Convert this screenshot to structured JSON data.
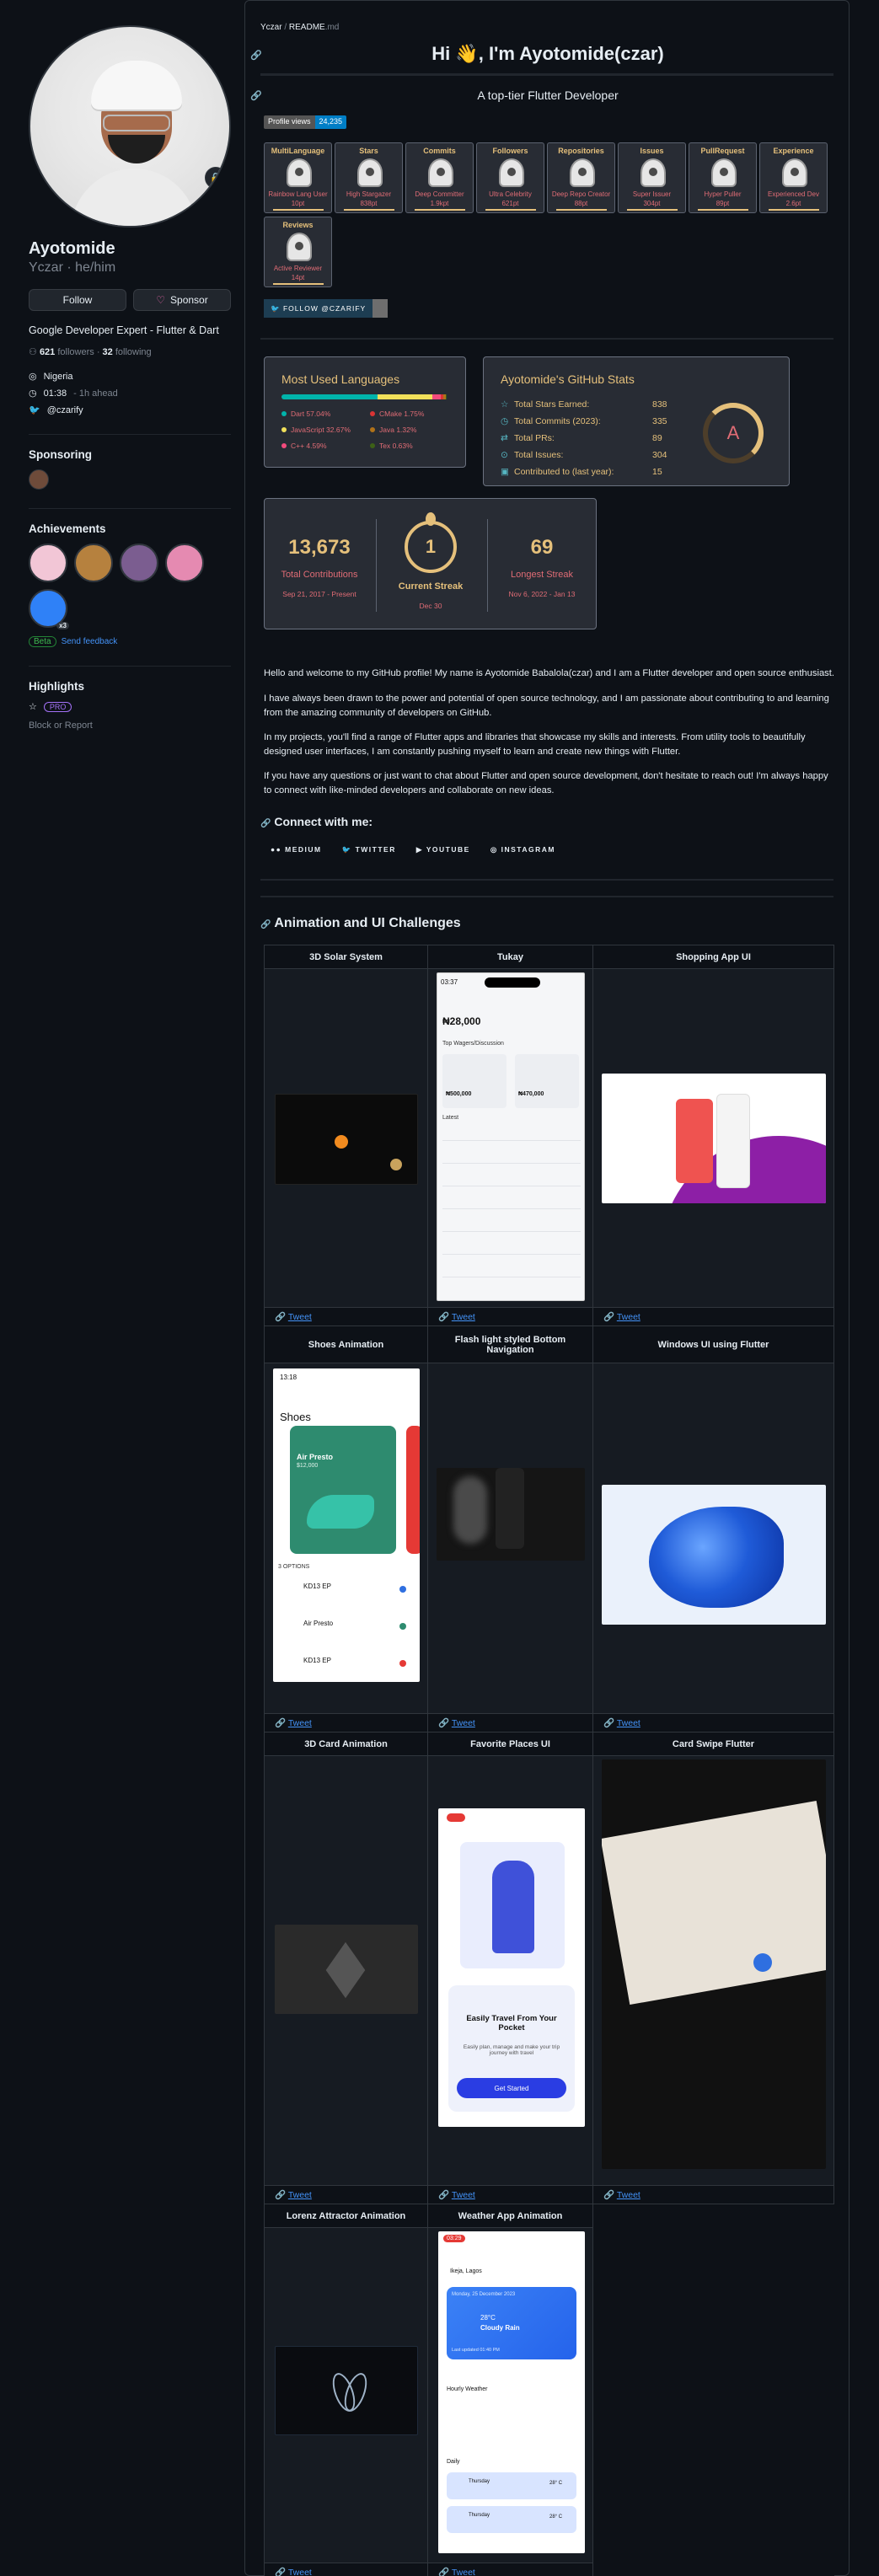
{
  "profile": {
    "name": "Ayotomide",
    "login": "Yczar · he/him",
    "follow_label": "Follow",
    "sponsor_label": "Sponsor",
    "bio": "Google Developer Expert - Flutter & Dart",
    "followers_count": "621",
    "followers_label": "followers",
    "following_count": "32",
    "following_label": "following",
    "location": "Nigeria",
    "local_time": "01:38",
    "time_note": "- 1h ahead",
    "twitter": "@czarify"
  },
  "sponsoring": {
    "heading": "Sponsoring"
  },
  "achievements": {
    "heading": "Achievements",
    "badge_count": "x3",
    "beta_label": "Beta",
    "feedback_label": "Send feedback"
  },
  "highlights": {
    "heading": "Highlights",
    "pro_label": "PRO"
  },
  "block_label": "Block or Report",
  "readme": {
    "breadcrumb_user": "Yczar",
    "breadcrumb_sep": " / ",
    "breadcrumb_file": "README",
    "breadcrumb_ext": ".md",
    "title": "Hi 👋, I'm Ayotomide(czar)",
    "subtitle": "A top-tier Flutter Developer",
    "profile_views_label": "Profile views",
    "profile_views_value": "24,235",
    "follow_badge": "FOLLOW @CZARIFY"
  },
  "trophies": [
    {
      "title": "MultiLanguage",
      "line1": "Rainbow Lang User",
      "line2": "10pt"
    },
    {
      "title": "Stars",
      "line1": "High Stargazer",
      "line2": "838pt"
    },
    {
      "title": "Commits",
      "line1": "Deep Committer",
      "line2": "1.9kpt"
    },
    {
      "title": "Followers",
      "line1": "Ultra Celebrity",
      "line2": "621pt"
    },
    {
      "title": "Repositories",
      "line1": "Deep Repo Creator",
      "line2": "88pt"
    },
    {
      "title": "Issues",
      "line1": "Super Issuer",
      "line2": "304pt"
    },
    {
      "title": "PullRequest",
      "line1": "Hyper Puller",
      "line2": "89pt"
    },
    {
      "title": "Experience",
      "line1": "Experienced Dev",
      "line2": "2.6pt"
    },
    {
      "title": "Reviews",
      "line1": "Active Reviewer",
      "line2": "14pt"
    }
  ],
  "languages": {
    "title": "Most Used Languages",
    "items": [
      {
        "name": "Dart 57.04%",
        "color": "#00B4AB",
        "pct": 57.04
      },
      {
        "name": "CMake 1.75%",
        "color": "#DA3434",
        "pct": 1.75
      },
      {
        "name": "JavaScript 32.67%",
        "color": "#f1e05a",
        "pct": 32.67
      },
      {
        "name": "Java 1.32%",
        "color": "#b07219",
        "pct": 1.32
      },
      {
        "name": "C++ 4.59%",
        "color": "#f34b7d",
        "pct": 4.59
      },
      {
        "name": "Tex 0.63%",
        "color": "#3D6117",
        "pct": 0.63
      }
    ]
  },
  "stats": {
    "title": "Ayotomide's GitHub Stats",
    "rows": [
      {
        "icon": "☆",
        "label": "Total Stars Earned:",
        "value": "838"
      },
      {
        "icon": "◷",
        "label": "Total Commits (2023):",
        "value": "335"
      },
      {
        "icon": "⇄",
        "label": "Total PRs:",
        "value": "89"
      },
      {
        "icon": "⊙",
        "label": "Total Issues:",
        "value": "304"
      },
      {
        "icon": "▣",
        "label": "Contributed to (last year):",
        "value": "15"
      }
    ],
    "rank": "A"
  },
  "streak": {
    "total_value": "13,673",
    "total_label": "Total Contributions",
    "total_range": "Sep 21, 2017 - Present",
    "current_value": "1",
    "current_label": "Current Streak",
    "current_date": "Dec 30",
    "longest_value": "69",
    "longest_label": "Longest Streak",
    "longest_range": "Nov 6, 2022 - Jan 13"
  },
  "intro": {
    "p1": "Hello and welcome to my GitHub profile! My name is Ayotomide Babalola(czar) and I am a Flutter developer and open source enthusiast.",
    "p2": "I have always been drawn to the power and potential of open source technology, and I am passionate about contributing to and learning from the amazing community of developers on GitHub.",
    "p3": "In my projects, you'll find a range of Flutter apps and libraries that showcase my skills and interests. From utility tools to beautifully designed user interfaces, I am constantly pushing myself to learn and create new things with Flutter.",
    "p4": "If you have any questions or just want to chat about Flutter and open source development, don't hesitate to reach out! I'm always happy to connect with like-minded developers and collaborate on new ideas."
  },
  "connect": {
    "heading": "Connect with me:",
    "links": [
      "MEDIUM",
      "TWITTER",
      "YOUTUBE",
      "INSTAGRAM"
    ]
  },
  "animations": {
    "heading": "Animation and UI Challenges",
    "tweet_label": "Tweet",
    "items": [
      "3D Solar System",
      "Tukay",
      "Shopping App UI",
      "Shoes Animation",
      "Flash light styled Bottom Navigation",
      "Windows UI using Flutter",
      "3D Card Animation",
      "Favorite Places UI",
      "Card Swipe Flutter",
      "Lorenz Attractor Animation",
      "Weather App Animation"
    ],
    "tukay": {
      "time": "03:37",
      "balance": "₦28,000",
      "section": "Top Wagers/Discussion",
      "amount1": "₦500,000",
      "amount2": "₦470,000",
      "latest": "Latest"
    },
    "shoes": {
      "time": "13:18",
      "title": "Shoes",
      "product": "Air Presto",
      "price": "$12,000",
      "options": "3 OPTIONS",
      "o1": "KD13 EP",
      "o2": "Air Presto",
      "o3": "KD13 EP",
      "o_price": "$12,000"
    },
    "places": {
      "title": "Easily Travel From Your Pocket",
      "desc": "Easily plan, manage and make your trip journey with travel",
      "cta": "Get Started"
    },
    "weather": {
      "badge": "03:29",
      "location": "Ikeja, Lagos",
      "date": "Monday, 25 December 2023",
      "temp": "28°C",
      "cond": "Cloudy Rain",
      "updated": "Last updated 01:40 PM",
      "hourly": "Hourly Weather",
      "daily": "Daily",
      "day1": "Thursday",
      "day2": "Thursday",
      "day_temp": "28° C"
    }
  },
  "colors": {
    "accent": "#4493f8",
    "gold": "#e5c07b",
    "rose": "#e06c75",
    "teal": "#56b6c2"
  }
}
